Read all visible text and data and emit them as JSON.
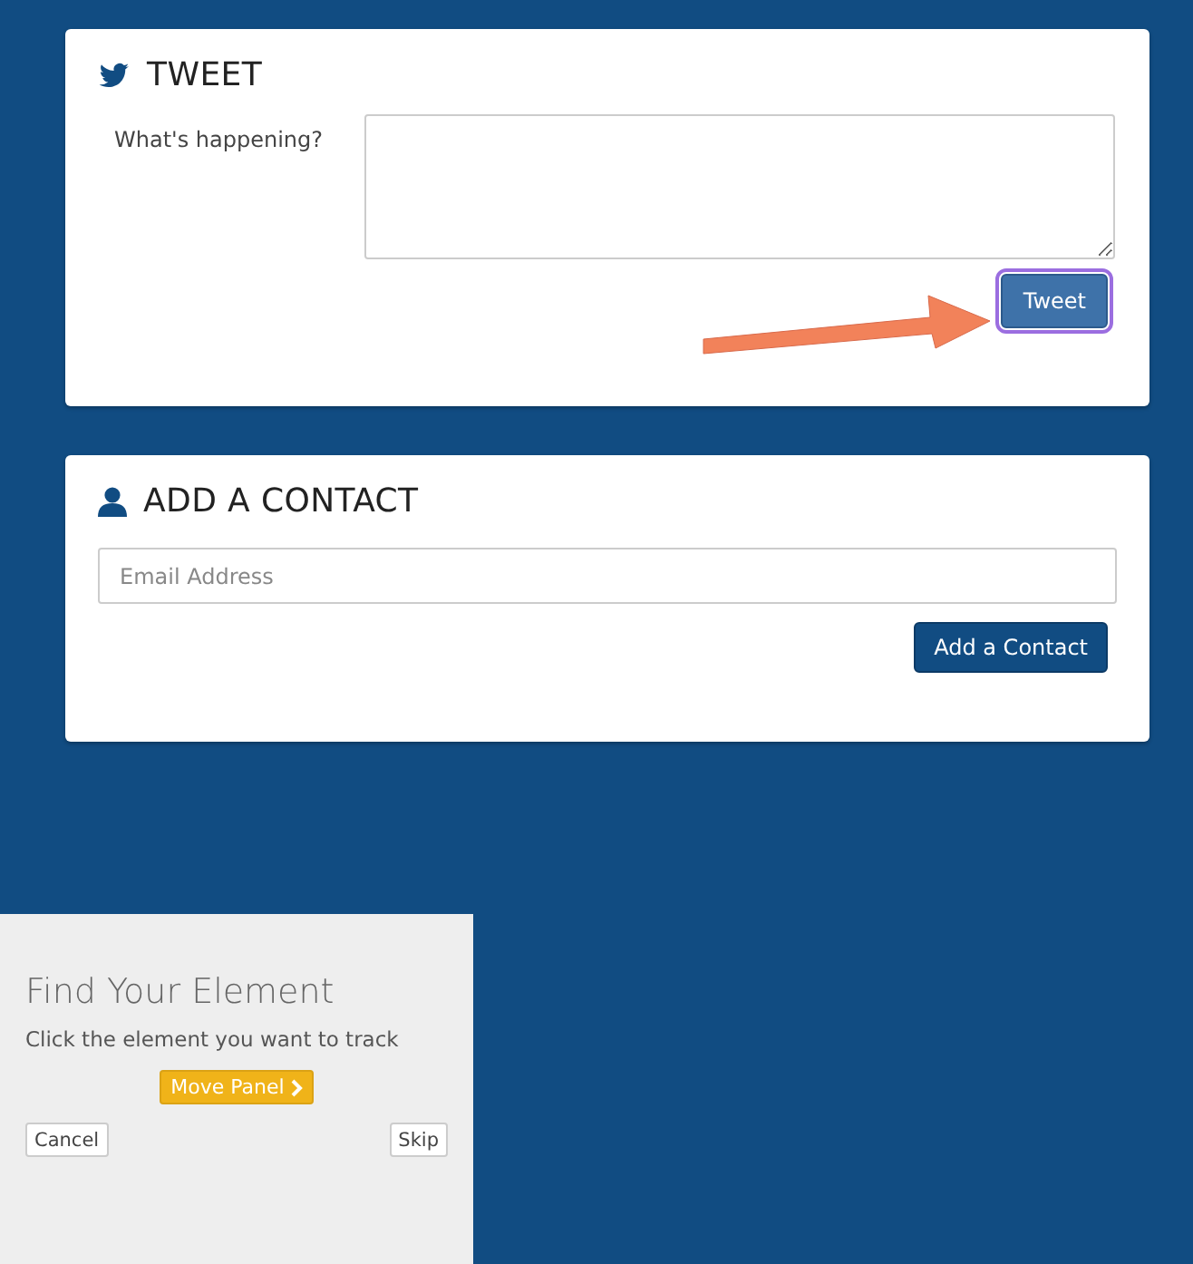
{
  "tweet_card": {
    "title": "TWEET",
    "field_label": "What's happening?",
    "button": {
      "label": "Tweet",
      "highlighted": true
    }
  },
  "contact_card": {
    "title": "ADD A CONTACT",
    "email_field": {
      "placeholder": "Email Address"
    },
    "button": {
      "label": "Add a Contact",
      "highlighted": false
    }
  },
  "tracker_panel": {
    "title": "Find Your Element",
    "instruction": "Click the element you want to track",
    "move_button": "Move Panel",
    "buttons": [
      {
        "label": "Cancel"
      },
      {
        "label": "Skip"
      }
    ]
  }
}
